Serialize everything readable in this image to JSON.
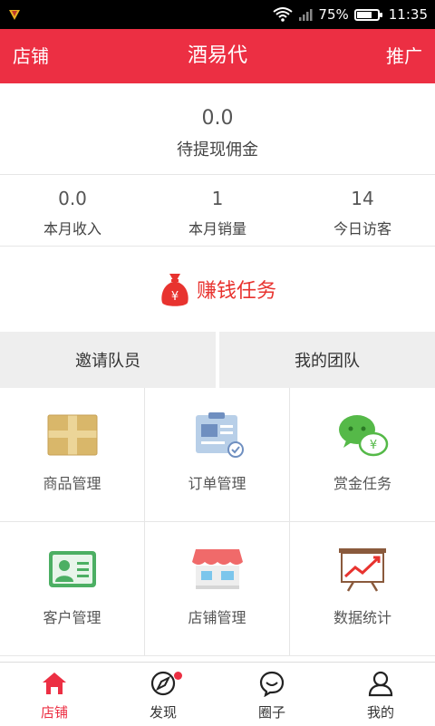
{
  "status_bar": {
    "battery": "75%",
    "time": "11:35",
    "battery_level": 0.75
  },
  "header": {
    "left_label": "店铺",
    "title": "酒易代",
    "right_label": "推广"
  },
  "pending": {
    "value": "0.0",
    "label": "待提现佣金"
  },
  "stats": [
    {
      "value": "0.0",
      "label": "本月收入"
    },
    {
      "value": "1",
      "label": "本月销量"
    },
    {
      "value": "14",
      "label": "今日访客"
    }
  ],
  "task": {
    "label": "赚钱任务",
    "icon": "money-bag-icon"
  },
  "team": {
    "invite_label": "邀请队员",
    "my_team_label": "我的团队"
  },
  "grid": [
    {
      "label": "商品管理",
      "icon": "box-icon"
    },
    {
      "label": "订单管理",
      "icon": "order-clipboard-icon"
    },
    {
      "label": "赏金任务",
      "icon": "wechat-reward-icon"
    },
    {
      "label": "客户管理",
      "icon": "contact-card-icon"
    },
    {
      "label": "店铺管理",
      "icon": "storefront-icon"
    },
    {
      "label": "数据统计",
      "icon": "chart-board-icon"
    }
  ],
  "tabbar": [
    {
      "label": "店铺",
      "icon": "home-icon",
      "active": true
    },
    {
      "label": "发现",
      "icon": "compass-icon",
      "badge": true
    },
    {
      "label": "圈子",
      "icon": "chat-bubble-icon"
    },
    {
      "label": "我的",
      "icon": "user-icon"
    }
  ],
  "colors": {
    "brand": "#ec2f43",
    "task_text": "#e8332f"
  }
}
